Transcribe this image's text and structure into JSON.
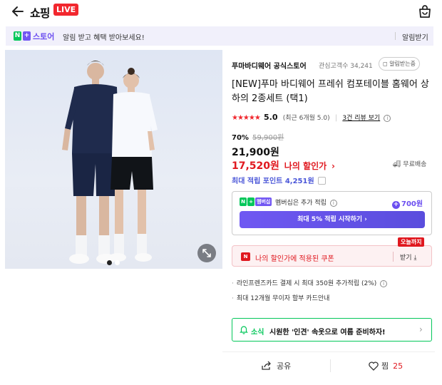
{
  "header": {
    "logo_text": "쇼핑",
    "live_label": "LIVE"
  },
  "banner": {
    "store_name": "스토어",
    "message": "알림 받고 혜택 받아보세요!",
    "action": "알림받기"
  },
  "product": {
    "seller": "푸마바디웨어 공식스토어",
    "interest": "관심고객수 34,241",
    "alarm_button": "알림받는중",
    "title": "[NEW]푸마 바디웨어 프레쉬 컴포테이블 홈웨어 상하의 2종세트 (택1)",
    "rating_score": "5.0",
    "rating_recent": "(최근 6개월 5.0)",
    "review_link": "3건 리뷰 보기",
    "discount_pct": "70%",
    "original_price": "59,900원",
    "price": "21,900원",
    "my_price": "17,520원",
    "my_price_label": "나의 할인가",
    "free_shipping": "무료배송",
    "max_points": "최대 적립 포인트 4,251원"
  },
  "membership": {
    "badge": "멤버십",
    "text": "멤버십은 추가 적립",
    "points": "700원",
    "cta": "최대 5% 적립 시작하기"
  },
  "coupon": {
    "text": "나의 할인가에 적용된 쿠폰",
    "get_label": "받기",
    "today_tag": "오늘까지"
  },
  "benefits": [
    "라인프렌즈카드 결제 시 최대 350원 추가적립 (2%)",
    "최대 12개월 무이자 할부 카드안내"
  ],
  "news": {
    "label": "소식",
    "text": "시원한 '인견' 속옷으로 여름 준비하자!"
  },
  "actions": {
    "share_label": "공유",
    "zzim_label": "찜",
    "zzim_count": "25"
  },
  "colors": {
    "brand_green": "#03c75a",
    "accent_red": "#e0181f",
    "membership_purple": "#6b4ef0"
  }
}
